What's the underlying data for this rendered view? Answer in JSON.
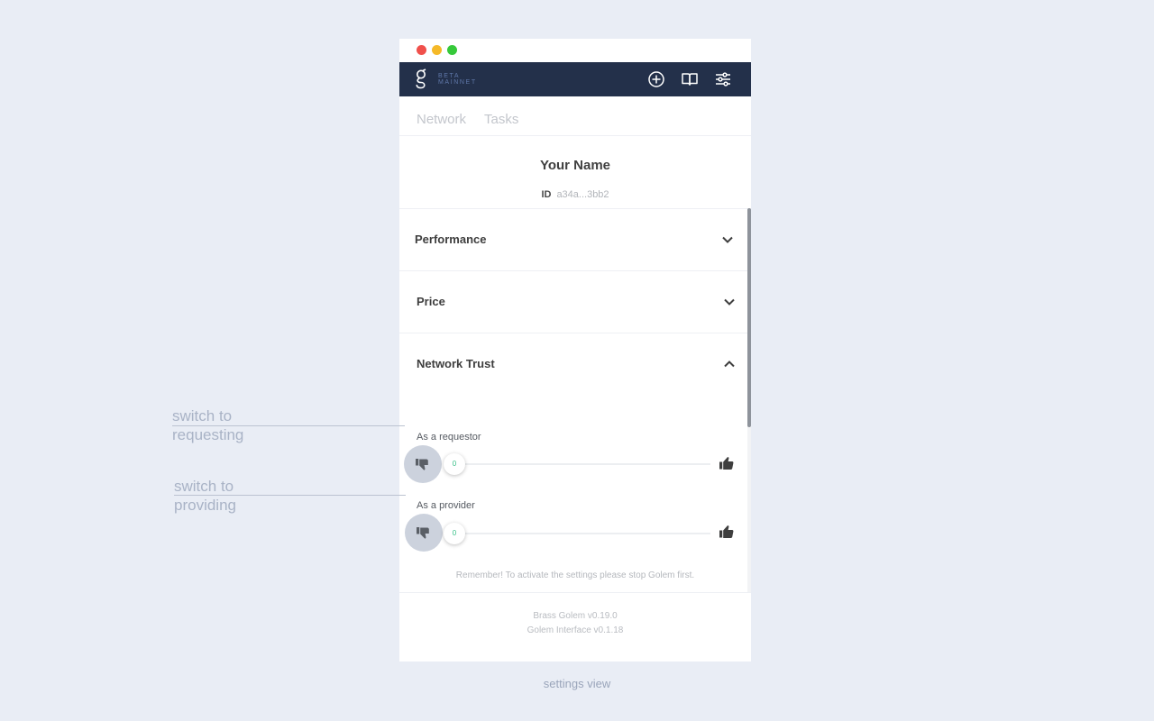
{
  "header": {
    "badge_line1": "BETA",
    "badge_line2": "MAINNET",
    "icons": [
      "add-icon",
      "docs-book-icon",
      "settings-sliders-icon"
    ]
  },
  "tabs": [
    {
      "label": "Network"
    },
    {
      "label": "Tasks"
    }
  ],
  "profile": {
    "name": "Your Name",
    "id_label": "ID",
    "id_value": "a34a...3bb2"
  },
  "sections": {
    "performance": "Performance",
    "price": "Price",
    "network_trust": "Network Trust"
  },
  "trust": {
    "requestor": {
      "label": "As a requestor",
      "value": "0"
    },
    "provider": {
      "label": "As a provider",
      "value": "0"
    }
  },
  "remember_text": "Remember! To activate the settings please stop Golem first.",
  "footer": {
    "line1": "Brass Golem v0.19.0",
    "line2": "Golem Interface v0.1.18"
  },
  "annotations": {
    "requesting_line1": "switch to",
    "requesting_line2": "requesting",
    "providing_line1": "switch to",
    "providing_line2": "providing"
  },
  "caption": "settings view",
  "colors": {
    "page_bg": "#e9edf5",
    "navbar": "#23304a",
    "accent_green": "#38c088",
    "switch_bg": "#ccd2dd"
  }
}
